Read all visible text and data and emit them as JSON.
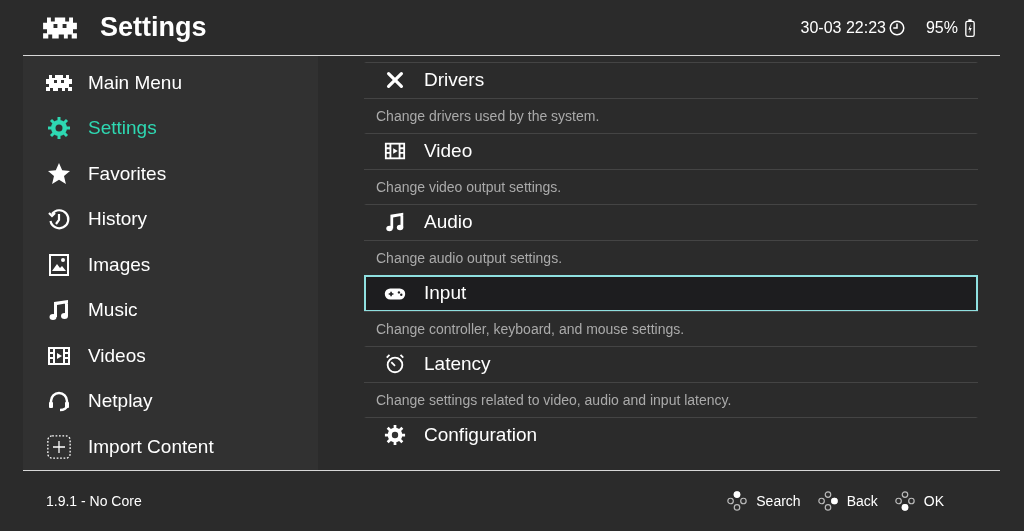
{
  "header": {
    "title": "Settings",
    "clock": "30-03 22:23",
    "battery": "95%"
  },
  "sidebar": {
    "items": [
      {
        "label": "Main Menu",
        "selected": false
      },
      {
        "label": "Settings",
        "selected": true
      },
      {
        "label": "Favorites",
        "selected": false
      },
      {
        "label": "History",
        "selected": false
      },
      {
        "label": "Images",
        "selected": false
      },
      {
        "label": "Music",
        "selected": false
      },
      {
        "label": "Videos",
        "selected": false
      },
      {
        "label": "Netplay",
        "selected": false
      },
      {
        "label": "Import Content",
        "selected": false
      }
    ]
  },
  "entries": [
    {
      "title": "Drivers",
      "description": "Change drivers used by the system.",
      "selected": false
    },
    {
      "title": "Video",
      "description": "Change video output settings.",
      "selected": false
    },
    {
      "title": "Audio",
      "description": "Change audio output settings.",
      "selected": false
    },
    {
      "title": "Input",
      "description": "Change controller, keyboard, and mouse settings.",
      "selected": true
    },
    {
      "title": "Latency",
      "description": "Change settings related to video, audio and input latency.",
      "selected": false
    },
    {
      "title": "Configuration",
      "selected": false
    }
  ],
  "footer": {
    "version": "1.9.1 - No Core",
    "actions": [
      {
        "label": "Search",
        "kind": "north"
      },
      {
        "label": "Back",
        "kind": "east"
      },
      {
        "label": "OK",
        "kind": "south"
      }
    ]
  }
}
